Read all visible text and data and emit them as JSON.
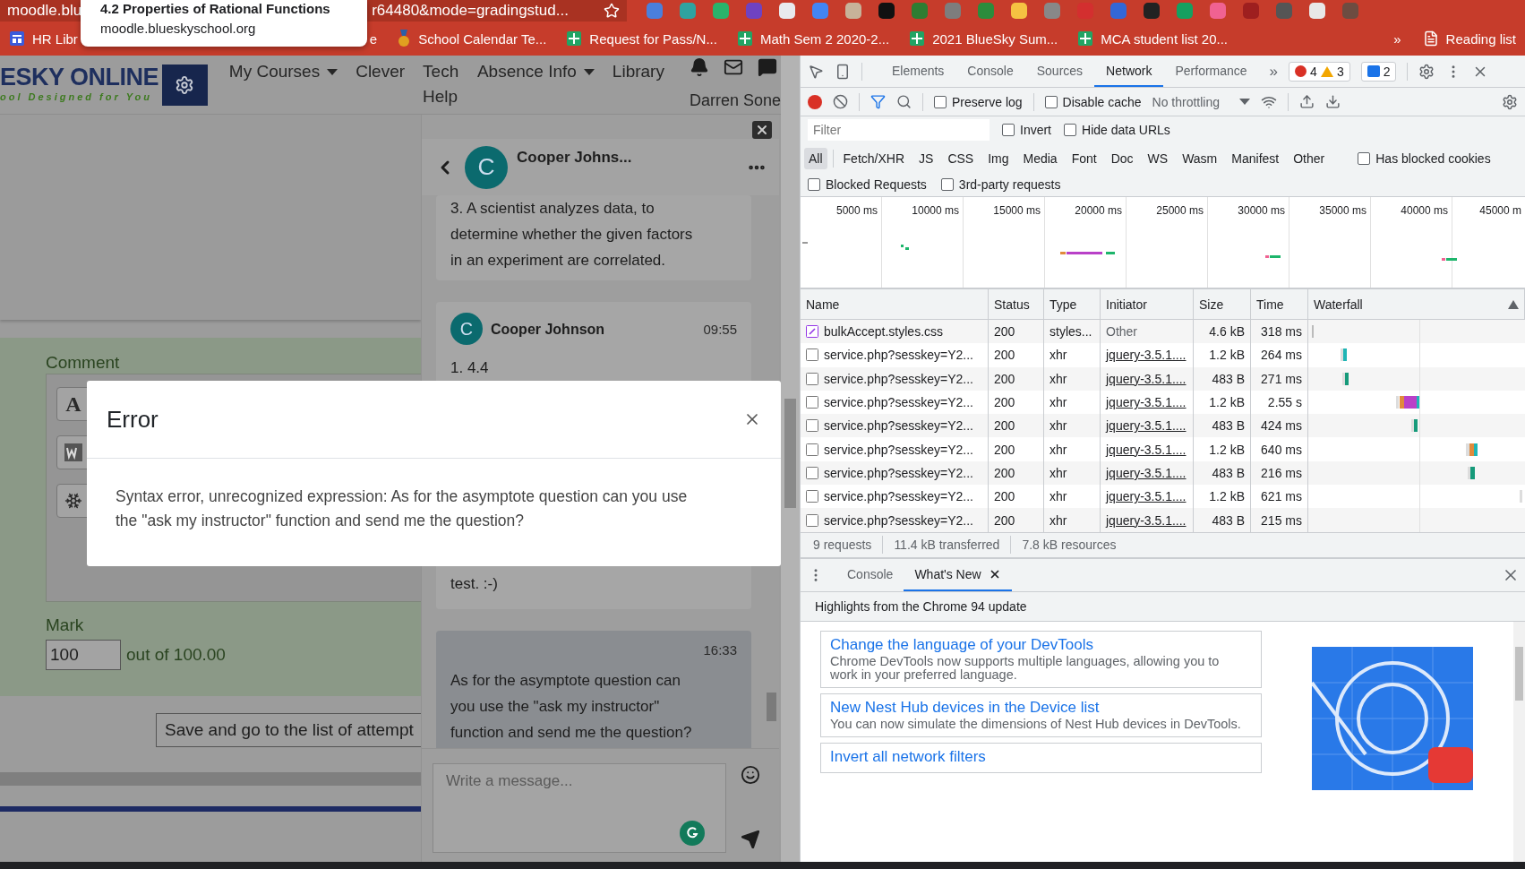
{
  "browser": {
    "url_start": "moodle.blu",
    "url_end": "r64480&mode=gradingstud...",
    "tooltip": {
      "title": "4.2 Properties of Rational Functions",
      "url": "moodle.blueskyschool.org"
    },
    "bookmarks": [
      {
        "label": "HR Libr",
        "kind": "apps"
      },
      {
        "label": "e",
        "kind": "none"
      },
      {
        "label": "School Calendar Te...",
        "kind": "calendar"
      },
      {
        "label": "Request for Pass/N...",
        "kind": "sheet"
      },
      {
        "label": "Math Sem 2 2020-2...",
        "kind": "sheet"
      },
      {
        "label": "2021 BlueSky Sum...",
        "kind": "sheet"
      },
      {
        "label": "MCA student list 20...",
        "kind": "sheet"
      }
    ],
    "more": "»",
    "reading_list": "Reading list"
  },
  "site": {
    "logo": "ESKY ONLINE",
    "tagline": "ool Designed for You",
    "menu": [
      {
        "label": "My Courses",
        "dropdown": true,
        "wrapped": false
      },
      {
        "label": "Clever",
        "dropdown": false,
        "wrapped": false
      },
      {
        "label": "Tech Help",
        "dropdown": false,
        "wrapped": true
      },
      {
        "label": "Absence Info",
        "dropdown": true,
        "wrapped": false
      },
      {
        "label": "Library",
        "dropdown": false,
        "wrapped": false
      }
    ],
    "user": "Darren Sone"
  },
  "grading": {
    "comment_label": "Comment",
    "editor_buttons": [
      {
        "kind": "text",
        "label": "A"
      },
      {
        "kind": "word"
      },
      {
        "kind": "snowflake"
      }
    ],
    "mark_label": "Mark",
    "mark_value": "100",
    "mark_suffix": "out of 100.00",
    "save_button": "Save and go to the list of attempt"
  },
  "chat": {
    "contact": "Cooper Johns...",
    "avatar": "C",
    "messages": [
      {
        "kind": "plain",
        "lines": [
          "3. A scientist analyzes data, to",
          "determine whether the given factors",
          "in an experiment are correlated."
        ]
      },
      {
        "kind": "incoming",
        "sender": "Cooper Johnson",
        "avatar": "C",
        "time": "09:55",
        "first": "1. 4.4",
        "last": "test. :-)"
      },
      {
        "kind": "outgoing",
        "time": "16:33",
        "lines": [
          "As for the asymptote question can",
          "you use the \"ask my instructor\"",
          "function and send me the question?"
        ]
      }
    ],
    "input": {
      "placeholder": "Write a message..."
    }
  },
  "modal": {
    "title": "Error",
    "lines": [
      "Syntax error, unrecognized expression: As for the asymptote question can you use",
      "the \"ask my instructor\" function and send me the question?"
    ]
  },
  "devtools": {
    "tabs": [
      {
        "label": "Elements",
        "selected": false
      },
      {
        "label": "Console",
        "selected": false
      },
      {
        "label": "Sources",
        "selected": false
      },
      {
        "label": "Network",
        "selected": true
      },
      {
        "label": "Performance",
        "selected": false
      }
    ],
    "more_tabs": "»",
    "errors": "4",
    "warnings": "3",
    "messages": "2",
    "recording": true,
    "toolbar_options": [
      {
        "label": "Preserve log",
        "checked": false
      },
      {
        "label": "Disable cache",
        "checked": false
      }
    ],
    "throttling": "No throttling",
    "filter": {
      "placeholder": "Filter"
    },
    "filter_options": [
      {
        "label": "Invert",
        "checked": false
      },
      {
        "label": "Hide data URLs",
        "checked": false
      }
    ],
    "types": [
      {
        "label": "All",
        "selected": true
      },
      {
        "label": "Fetch/XHR",
        "selected": false
      },
      {
        "label": "JS",
        "selected": false
      },
      {
        "label": "CSS",
        "selected": false
      },
      {
        "label": "Img",
        "selected": false
      },
      {
        "label": "Media",
        "selected": false
      },
      {
        "label": "Font",
        "selected": false
      },
      {
        "label": "Doc",
        "selected": false
      },
      {
        "label": "WS",
        "selected": false
      },
      {
        "label": "Wasm",
        "selected": false
      },
      {
        "label": "Manifest",
        "selected": false
      },
      {
        "label": "Other",
        "selected": false
      }
    ],
    "blocked_cookies": {
      "label": "Has blocked cookies",
      "checked": false
    },
    "extra_filters": [
      {
        "label": "Blocked Requests",
        "checked": false
      },
      {
        "label": "3rd-party requests",
        "checked": false
      }
    ],
    "overview_ticks": [
      "5000 ms",
      "10000 ms",
      "15000 ms",
      "20000 ms",
      "25000 ms",
      "30000 ms",
      "35000 ms",
      "40000 ms",
      "45000 m"
    ],
    "columns": [
      "Name",
      "Status",
      "Type",
      "Initiator",
      "Size",
      "Time",
      "Waterfall"
    ],
    "requests": [
      {
        "kind": "stylesheet",
        "name": "bulkAccept.styles.css",
        "status": "200",
        "type": "styles...",
        "initiator": "Other",
        "initiator_link": false,
        "size": "4.6 kB",
        "time": "318 ms"
      },
      {
        "kind": "document",
        "name": "service.php?sesskey=Y2...",
        "status": "200",
        "type": "xhr",
        "initiator": "jquery-3.5.1....",
        "initiator_link": true,
        "size": "1.2 kB",
        "time": "264 ms"
      },
      {
        "kind": "document",
        "name": "service.php?sesskey=Y2...",
        "status": "200",
        "type": "xhr",
        "initiator": "jquery-3.5.1....",
        "initiator_link": true,
        "size": "483 B",
        "time": "271 ms"
      },
      {
        "kind": "document",
        "name": "service.php?sesskey=Y2...",
        "status": "200",
        "type": "xhr",
        "initiator": "jquery-3.5.1....",
        "initiator_link": true,
        "size": "1.2 kB",
        "time": "2.55 s"
      },
      {
        "kind": "document",
        "name": "service.php?sesskey=Y2...",
        "status": "200",
        "type": "xhr",
        "initiator": "jquery-3.5.1....",
        "initiator_link": true,
        "size": "483 B",
        "time": "424 ms"
      },
      {
        "kind": "document",
        "name": "service.php?sesskey=Y2...",
        "status": "200",
        "type": "xhr",
        "initiator": "jquery-3.5.1....",
        "initiator_link": true,
        "size": "1.2 kB",
        "time": "640 ms"
      },
      {
        "kind": "document",
        "name": "service.php?sesskey=Y2...",
        "status": "200",
        "type": "xhr",
        "initiator": "jquery-3.5.1....",
        "initiator_link": true,
        "size": "483 B",
        "time": "216 ms"
      },
      {
        "kind": "document",
        "name": "service.php?sesskey=Y2...",
        "status": "200",
        "type": "xhr",
        "initiator": "jquery-3.5.1....",
        "initiator_link": true,
        "size": "1.2 kB",
        "time": "621 ms"
      },
      {
        "kind": "document",
        "name": "service.php?sesskey=Y2...",
        "status": "200",
        "type": "xhr",
        "initiator": "jquery-3.5.1....",
        "initiator_link": true,
        "size": "483 B",
        "time": "215 ms"
      }
    ],
    "summary": [
      "9 requests",
      "11.4 kB transferred",
      "7.8 kB resources"
    ],
    "drawer": {
      "tabs": [
        {
          "label": "Console",
          "selected": false,
          "closable": false
        },
        {
          "label": "What's New",
          "selected": true,
          "closable": true
        }
      ],
      "heading": "Highlights from the Chrome 94 update",
      "articles": [
        {
          "title": "Change the language of your DevTools",
          "lines": [
            "Chrome DevTools now supports multiple languages, allowing you to",
            "work in your preferred language."
          ]
        },
        {
          "title": "New Nest Hub devices in the Device list",
          "lines": [
            "You can now simulate the dimensions of Nest Hub devices in DevTools."
          ]
        },
        {
          "title": "Invert all network filters"
        }
      ]
    }
  }
}
